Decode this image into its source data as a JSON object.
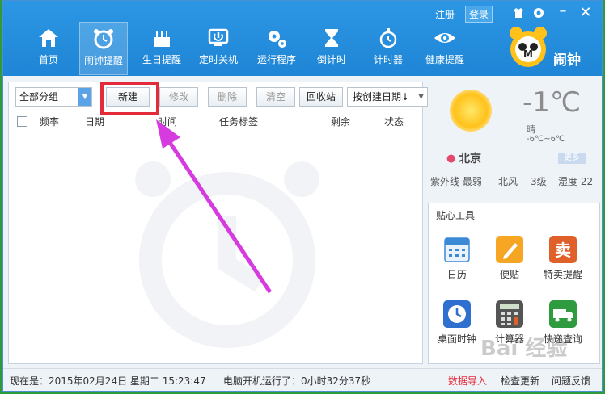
{
  "topbar": {
    "register": "注册",
    "login": "登录"
  },
  "nav": [
    {
      "label": "首页",
      "icon": "home-icon"
    },
    {
      "label": "闹钟提醒",
      "icon": "alarm-clock-icon",
      "active": true
    },
    {
      "label": "生日提醒",
      "icon": "birthday-cake-icon"
    },
    {
      "label": "定时关机",
      "icon": "power-icon"
    },
    {
      "label": "运行程序",
      "icon": "gears-icon"
    },
    {
      "label": "倒计时",
      "icon": "hourglass-icon"
    },
    {
      "label": "计时器",
      "icon": "stopwatch-icon"
    },
    {
      "label": "健康提醒",
      "icon": "eye-icon"
    }
  ],
  "logo": {
    "text": "闹钟"
  },
  "toolbar": {
    "group_select": "全部分组",
    "new": "新建",
    "edit": "修改",
    "delete": "删除",
    "clear": "清空",
    "recycle": "回收站",
    "sort": "按创建日期↓"
  },
  "table": {
    "columns": [
      "频率",
      "日期",
      "时间",
      "任务标签",
      "剩余",
      "状态"
    ]
  },
  "weather": {
    "temp": "-1℃",
    "condition": "晴",
    "range": "-6℃~6℃",
    "city": "北京",
    "more": "更多",
    "uv": "紫外线 最弱",
    "wind": "北风",
    "level": "3级",
    "humidity": "湿度 22"
  },
  "tools": {
    "title": "贴心工具",
    "items": [
      {
        "label": "日历",
        "icon": "calendar-icon"
      },
      {
        "label": "便贴",
        "icon": "sticky-note-icon"
      },
      {
        "label": "特卖提醒",
        "icon": "sale-icon"
      },
      {
        "label": "桌面时钟",
        "icon": "desktop-clock-icon"
      },
      {
        "label": "计算器",
        "icon": "calculator-icon"
      },
      {
        "label": "快递查询",
        "icon": "delivery-truck-icon"
      }
    ]
  },
  "status": {
    "now": "现在是：2015年02月24日  星期二  15:23:47",
    "uptime": "电脑开机运行了：0小时32分37秒",
    "import": "数据导入",
    "update": "检查更新",
    "feedback": "问题反馈"
  },
  "watermark": "Bai 经验",
  "colors": {
    "header": "#2c97e4",
    "highlight": "#e32b3a",
    "arrow": "#d63be0"
  }
}
